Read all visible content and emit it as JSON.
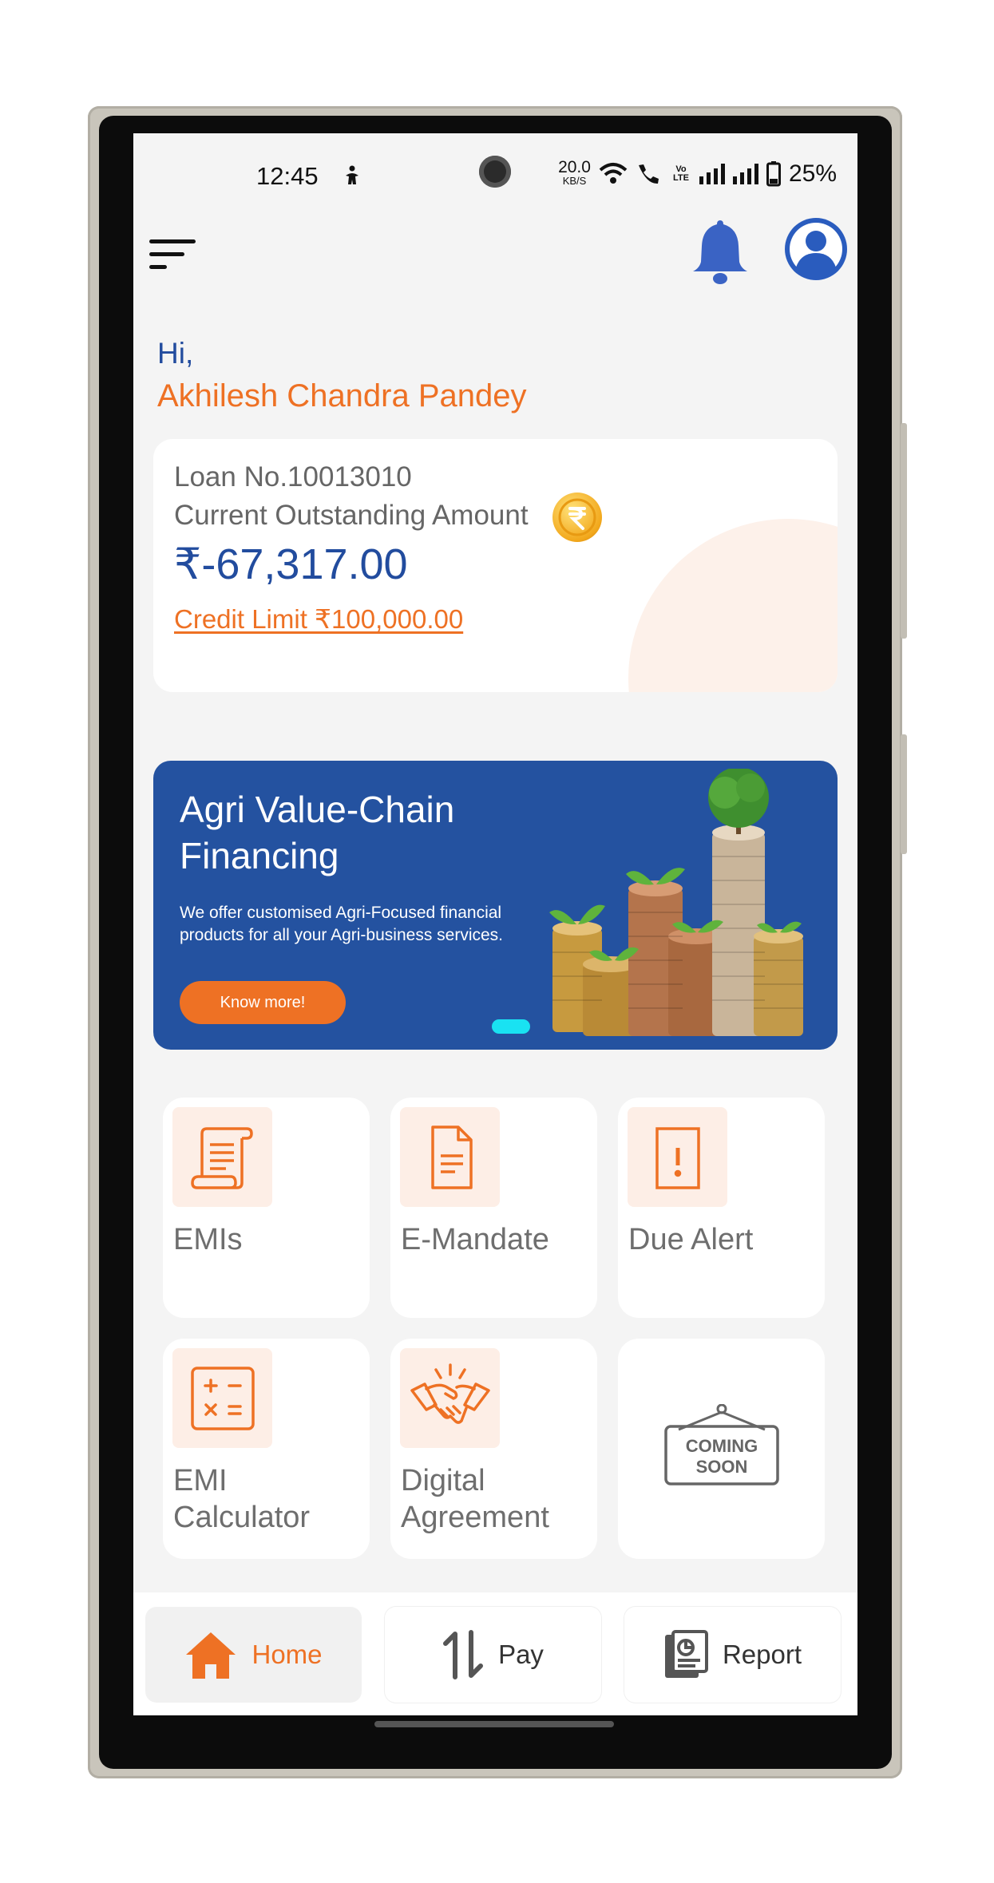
{
  "status_bar": {
    "time": "12:45",
    "net_speed_value": "20.0",
    "net_speed_unit": "KB/S",
    "volte": "Vo LTE",
    "battery": "25%"
  },
  "header": {
    "menu_icon": "menu-icon",
    "notification_icon": "bell-icon",
    "profile_icon": "user-avatar-icon"
  },
  "greeting": {
    "hi": "Hi,",
    "name": "Akhilesh Chandra Pandey"
  },
  "loan_card": {
    "loan_number": "Loan No.10013010",
    "outstanding_label": "Current Outstanding Amount",
    "outstanding_amount": "₹-67,317.00",
    "credit_limit": "Credit Limit ₹100,000.00",
    "coin_icon": "rupee-coin-icon"
  },
  "banner": {
    "title": "Agri Value-Chain Financing",
    "description": "We offer customised Agri-Focused financial products for all your Agri-business services.",
    "button_label": "Know more!",
    "active_slide": 1
  },
  "tiles": [
    {
      "label": "EMIs",
      "icon": "scroll-document-icon"
    },
    {
      "label": "E-Mandate",
      "icon": "document-icon"
    },
    {
      "label": "Due Alert",
      "icon": "alert-document-icon"
    },
    {
      "label": "EMI Calculator",
      "icon": "calculator-icon"
    },
    {
      "label": "Digital Agreement",
      "icon": "handshake-icon"
    },
    {
      "label": "COMING SOON",
      "icon": "coming-soon-sign-icon"
    }
  ],
  "bottom_nav": [
    {
      "label": "Home",
      "icon": "home-icon",
      "active": true
    },
    {
      "label": "Pay",
      "icon": "transfer-arrows-icon",
      "active": false
    },
    {
      "label": "Report",
      "icon": "report-icon",
      "active": false
    }
  ],
  "colors": {
    "brand_blue": "#224c9e",
    "brand_orange": "#ee7124",
    "banner_blue": "#2452a0",
    "tile_icon_bg": "#fdeee6",
    "screen_bg": "#f4f4f4"
  }
}
